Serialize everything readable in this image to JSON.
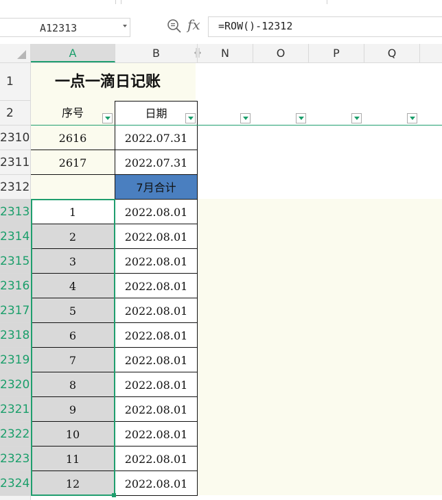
{
  "name_box": {
    "value": "A12313"
  },
  "formula_bar": {
    "formula": "=ROW()-12312",
    "fx_label": "fx"
  },
  "columns": [
    "A",
    "B",
    "N",
    "O",
    "P",
    "Q"
  ],
  "rows": {
    "title_row": "1",
    "header_row": "2",
    "numbers": [
      "2310",
      "2311",
      "2312",
      "2313",
      "2314",
      "2315",
      "2316",
      "2317",
      "2318",
      "2319",
      "2320",
      "2321",
      "2322",
      "2323",
      "2324"
    ]
  },
  "sheet": {
    "title": "一点一滴日记账",
    "headers": {
      "seq": "序号",
      "date": "日期"
    },
    "data": [
      {
        "seq": "2616",
        "date": "2022.07.31"
      },
      {
        "seq": "2617",
        "date": "2022.07.31"
      },
      {
        "seq": "",
        "date": "7月合计"
      },
      {
        "seq": "1",
        "date": "2022.08.01"
      },
      {
        "seq": "2",
        "date": "2022.08.01"
      },
      {
        "seq": "3",
        "date": "2022.08.01"
      },
      {
        "seq": "4",
        "date": "2022.08.01"
      },
      {
        "seq": "5",
        "date": "2022.08.01"
      },
      {
        "seq": "6",
        "date": "2022.08.01"
      },
      {
        "seq": "7",
        "date": "2022.08.01"
      },
      {
        "seq": "8",
        "date": "2022.08.01"
      },
      {
        "seq": "9",
        "date": "2022.08.01"
      },
      {
        "seq": "10",
        "date": "2022.08.01"
      },
      {
        "seq": "11",
        "date": "2022.08.01"
      },
      {
        "seq": "12",
        "date": "2022.08.01"
      }
    ]
  },
  "colors": {
    "accent_green": "#1f9e6e",
    "subtotal_blue": "#4a7fc0",
    "cream": "#fbfbee",
    "selection_grey": "#d9d9d9"
  },
  "icons": [
    "zoom-formula-icon",
    "filter-dropdown-icon",
    "name-box-dropdown-icon",
    "column-split-icon"
  ]
}
